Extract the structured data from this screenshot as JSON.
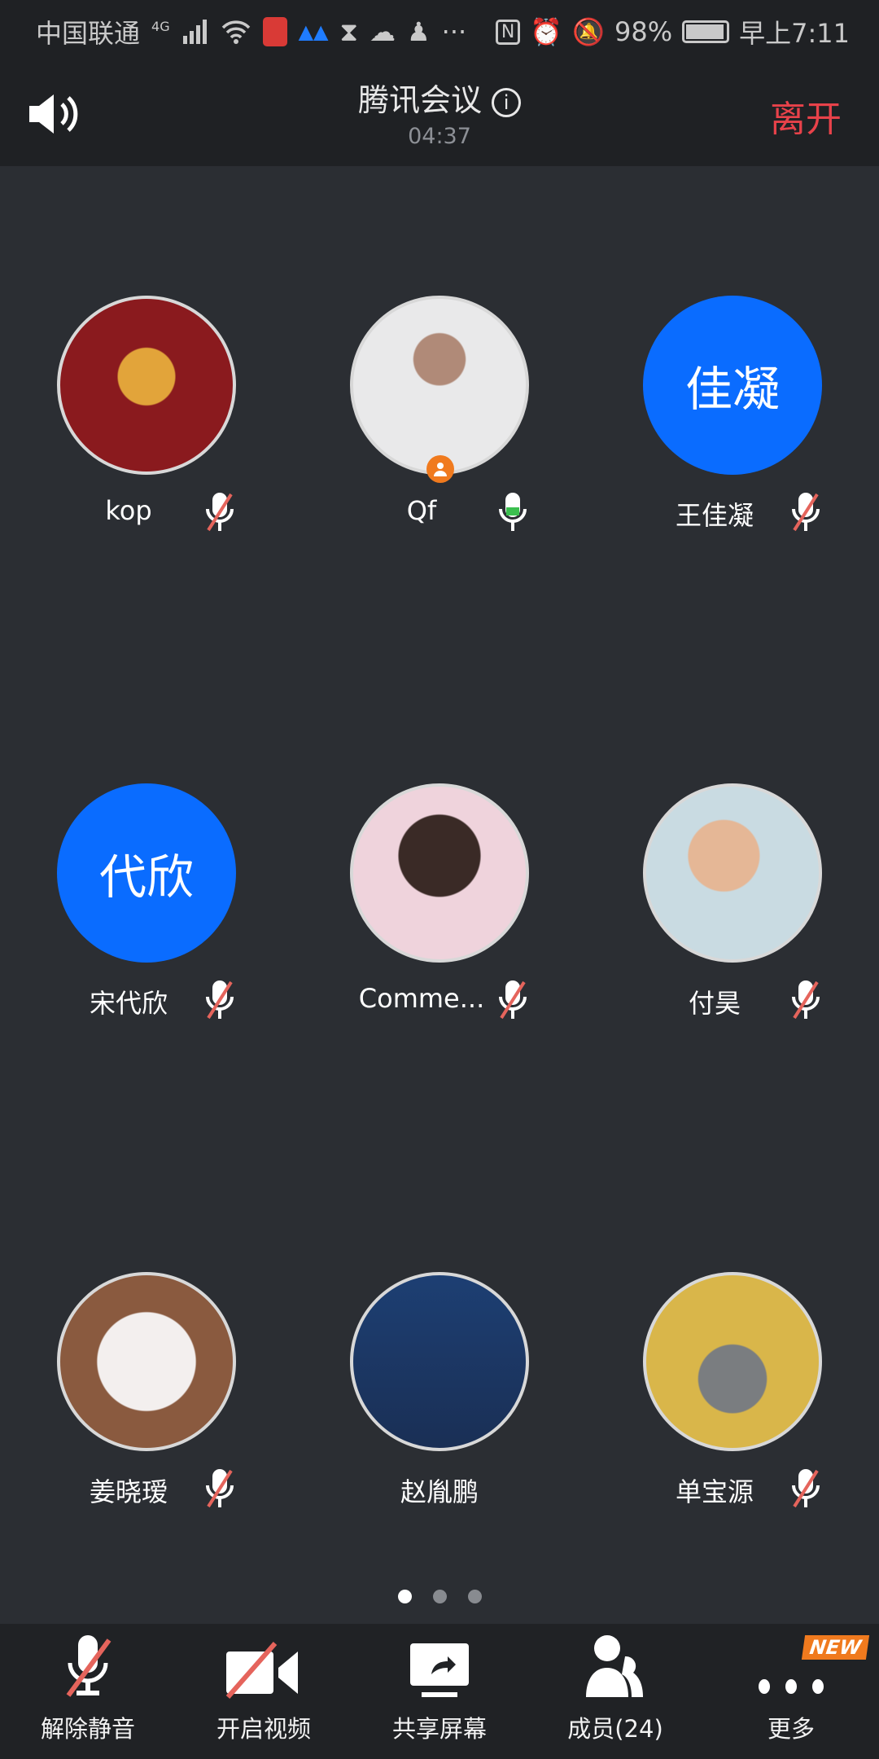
{
  "status_bar": {
    "carrier": "中国联通",
    "network": "4G",
    "battery": "98%",
    "time": "早上7:11"
  },
  "header": {
    "title": "腾讯会议",
    "timer": "04:37",
    "leave_label": "离开"
  },
  "colors": {
    "accent": "#0a6cff",
    "leave": "#e8424a",
    "muted_slash": "#e5645c",
    "speaking": "#3bbf4f",
    "host_badge": "#f07a1e"
  },
  "participants": [
    {
      "name": "kop",
      "mic": "muted",
      "avatar": "photo"
    },
    {
      "name": "Qf",
      "mic": "speaking",
      "avatar": "photo",
      "host": true
    },
    {
      "name": "王佳凝",
      "mic": "muted",
      "avatar_text": "佳凝"
    },
    {
      "name": "宋代欣",
      "mic": "muted",
      "avatar_text": "代欣"
    },
    {
      "name": "Comme...",
      "mic": "muted",
      "avatar": "photo"
    },
    {
      "name": "付昊",
      "mic": "muted",
      "avatar": "photo"
    },
    {
      "name": "姜晓瑷",
      "mic": "muted",
      "avatar": "photo"
    },
    {
      "name": "赵胤鹏",
      "mic": "none",
      "avatar": "photo"
    },
    {
      "name": "单宝源",
      "mic": "muted",
      "avatar": "photo"
    }
  ],
  "pagination": {
    "pages": 3,
    "current": 1
  },
  "toolbar": [
    {
      "label": "解除静音",
      "icon": "mic-muted-icon"
    },
    {
      "label": "开启视频",
      "icon": "video-off-icon"
    },
    {
      "label": "共享屏幕",
      "icon": "share-screen-icon"
    },
    {
      "label": "成员(24)",
      "icon": "members-icon"
    },
    {
      "label": "更多",
      "icon": "more-icon",
      "badge": "NEW"
    }
  ]
}
